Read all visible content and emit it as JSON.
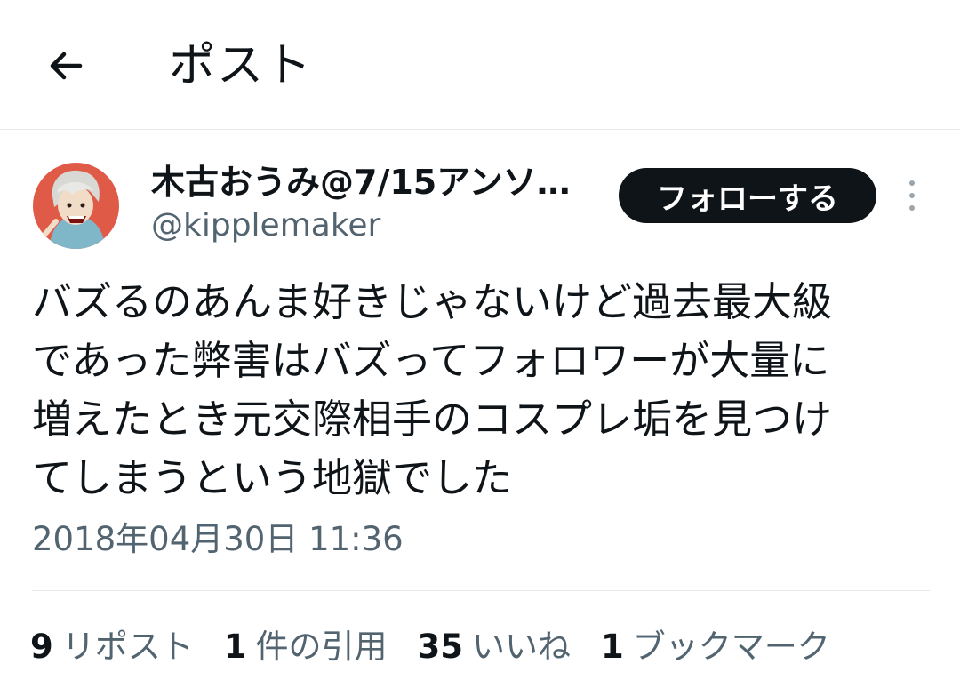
{
  "header": {
    "title": "ポスト",
    "back_icon": "arrow-left-icon"
  },
  "author": {
    "display_name": "木古おうみ@7/15アンソ…",
    "handle": "@kipplemaker",
    "avatar_icon": "avatar-illustration"
  },
  "follow_button": {
    "label": "フォローする"
  },
  "tweet": {
    "lines": [
      "バズるのあんま好きじゃないけど過去最大級",
      "であった弊害はバズってフォロワーが大量に",
      "増えたとき元交際相手のコスプレ垢を見つけ",
      "てしまうという地獄でした"
    ],
    "timestamp": "2018年04月30日 11:36"
  },
  "stats": [
    {
      "count": "9",
      "label": "リポスト"
    },
    {
      "count": "1",
      "label": "件の引用"
    },
    {
      "count": "35",
      "label": "いいね"
    },
    {
      "count": "1",
      "label": "ブックマーク"
    }
  ],
  "colors": {
    "text_primary": "#0f1419",
    "text_secondary": "#536471",
    "divider": "#e6e9eb",
    "follow_bg": "#0f1419",
    "follow_text": "#ffffff"
  }
}
